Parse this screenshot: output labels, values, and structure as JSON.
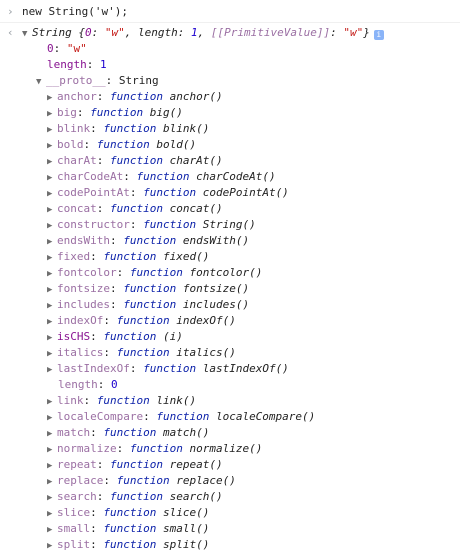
{
  "input": {
    "prompt_icon": "chevron-right",
    "text": "new String('w');"
  },
  "result": {
    "prompt_icon": "chevron-left",
    "type": "String",
    "preview": "{0: \"w\", length: 1, [[PrimitiveValue]]: \"w\"}",
    "info_icon": "i"
  },
  "own_props": [
    {
      "key": "0",
      "value": "\"w\"",
      "kind": "str"
    },
    {
      "key": "length",
      "value": "1",
      "kind": "num"
    }
  ],
  "proto": {
    "key": "__proto__",
    "value": "String"
  },
  "proto_members": [
    {
      "key": "anchor",
      "sig": "anchor()"
    },
    {
      "key": "big",
      "sig": "big()"
    },
    {
      "key": "blink",
      "sig": "blink()"
    },
    {
      "key": "bold",
      "sig": "bold()"
    },
    {
      "key": "charAt",
      "sig": "charAt()"
    },
    {
      "key": "charCodeAt",
      "sig": "charCodeAt()"
    },
    {
      "key": "codePointAt",
      "sig": "codePointAt()"
    },
    {
      "key": "concat",
      "sig": "concat()"
    },
    {
      "key": "constructor",
      "sig": "String()"
    },
    {
      "key": "endsWith",
      "sig": "endsWith()"
    },
    {
      "key": "fixed",
      "sig": "fixed()"
    },
    {
      "key": "fontcolor",
      "sig": "fontcolor()"
    },
    {
      "key": "fontsize",
      "sig": "fontsize()"
    },
    {
      "key": "includes",
      "sig": "includes()"
    },
    {
      "key": "indexOf",
      "sig": "indexOf()"
    },
    {
      "key": "isCHS",
      "sig": "(i)",
      "own": true
    },
    {
      "key": "italics",
      "sig": "italics()"
    },
    {
      "key": "lastIndexOf",
      "sig": "lastIndexOf()"
    },
    {
      "key": "length",
      "value": "0",
      "plain": true
    },
    {
      "key": "link",
      "sig": "link()"
    },
    {
      "key": "localeCompare",
      "sig": "localeCompare()"
    },
    {
      "key": "match",
      "sig": "match()"
    },
    {
      "key": "normalize",
      "sig": "normalize()"
    },
    {
      "key": "repeat",
      "sig": "repeat()"
    },
    {
      "key": "replace",
      "sig": "replace()"
    },
    {
      "key": "search",
      "sig": "search()"
    },
    {
      "key": "slice",
      "sig": "slice()"
    },
    {
      "key": "small",
      "sig": "small()"
    },
    {
      "key": "split",
      "sig": "split()"
    }
  ],
  "labels": {
    "function_kw": "function",
    "colon": ": "
  }
}
